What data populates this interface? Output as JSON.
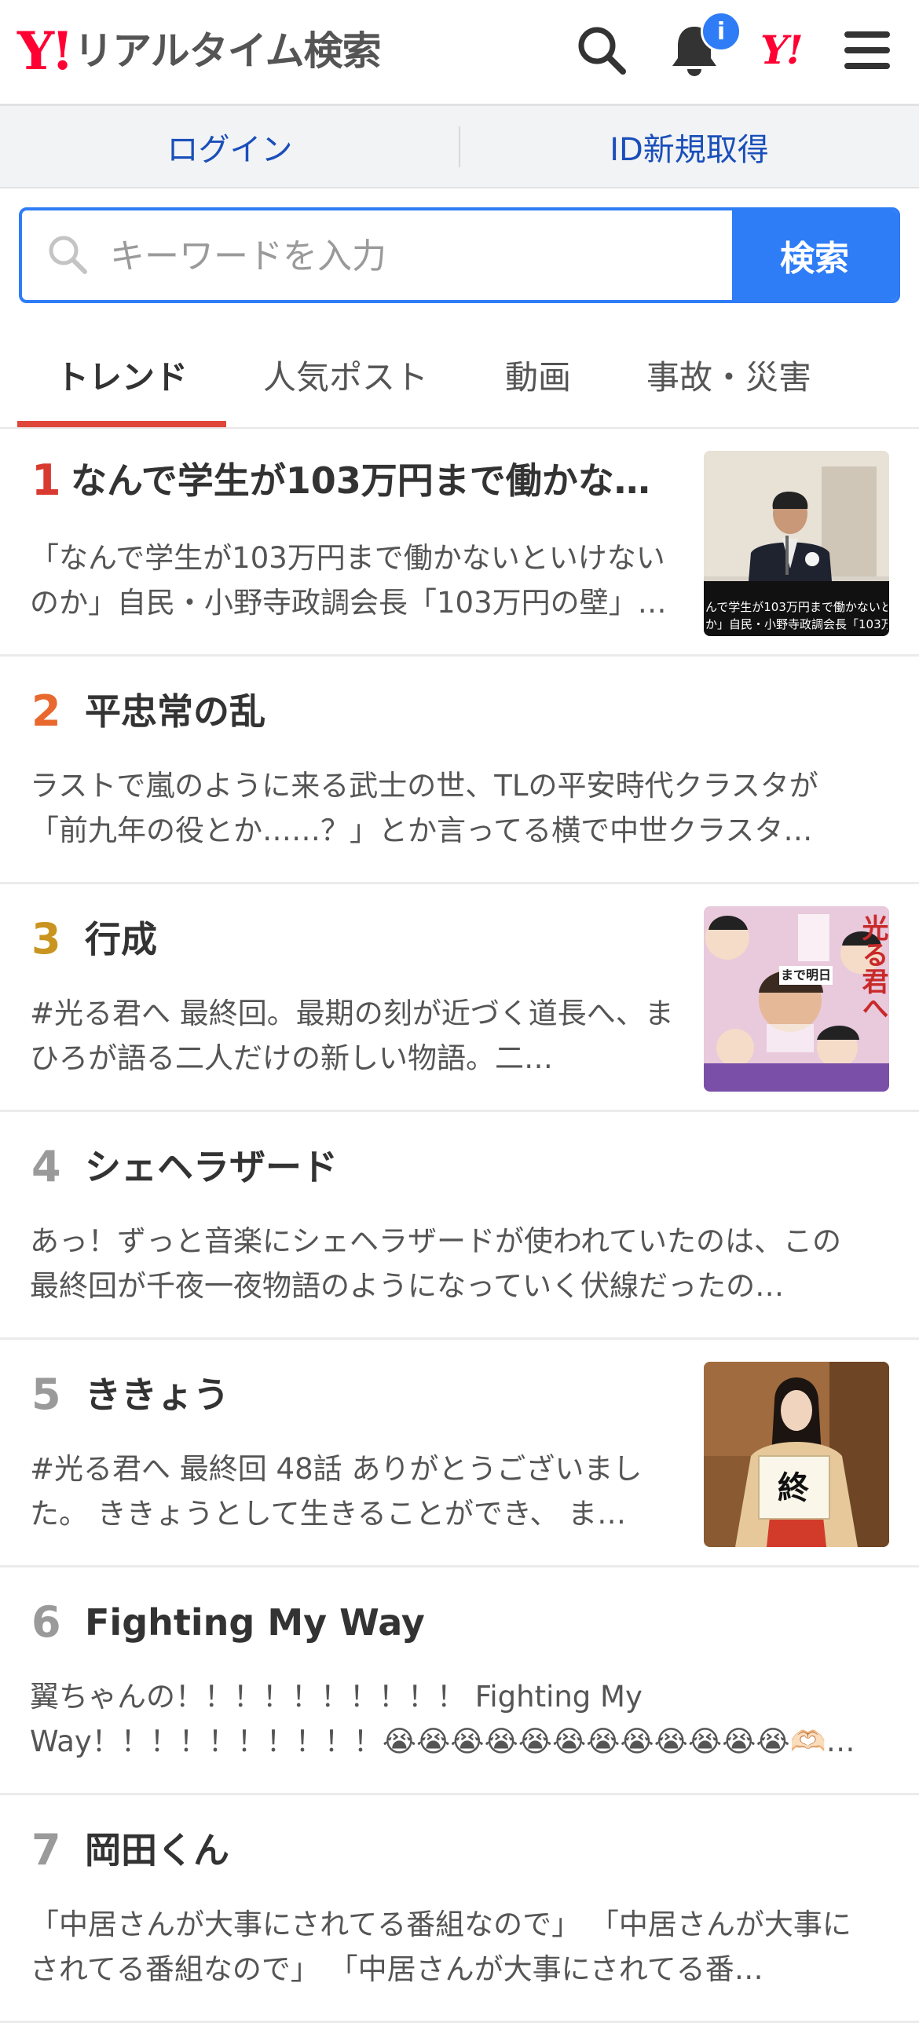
{
  "header": {
    "logo_mark": "Y!",
    "logo_text": "リアルタイム検索",
    "notification_badge": "i",
    "yahoo_mini_logo": "Y!",
    "icons": [
      "search-icon",
      "bell-icon",
      "yahoo-logo-icon",
      "menu-icon"
    ]
  },
  "auth": {
    "login": "ログイン",
    "signup": "ID新規取得"
  },
  "search": {
    "placeholder": "キーワードを入力",
    "value": "",
    "button": "検索"
  },
  "tabs": [
    {
      "label": "トレンド",
      "active": true
    },
    {
      "label": "人気ポスト",
      "active": false
    },
    {
      "label": "動画",
      "active": false
    },
    {
      "label": "事故・災害",
      "active": false
    }
  ],
  "colors": {
    "accent_blue": "#2e7cf6",
    "link_blue": "#1a4fba",
    "tab_underline": "#e0473a",
    "rank1": "#d93a30",
    "rank2": "#e8682e",
    "rank3": "#c99520",
    "rank_other": "#9a9a9a"
  },
  "trends": [
    {
      "rank": "1",
      "title": "なんで学生が103万円まで働かな…",
      "desc": "「なんで学生が103万円まで働かないといけないのか」自民・小野寺政調会長「103万円の壁」…",
      "thumbnail": true,
      "thumb_caption_1": "んで学生が103万円まで働かないとい",
      "thumb_caption_2": "か」自民・小野寺政調会長「103万円…"
    },
    {
      "rank": "2",
      "title": "平忠常の乱",
      "desc": "ラストで嵐のように来る武士の世、TLの平安時代クラスタが「前九年の役とか……？」とか言ってる横で中世クラスタ…",
      "thumbnail": false
    },
    {
      "rank": "3",
      "title": "行成",
      "desc": "#光る君へ 最終回。最期の刻が近づく道長へ、まひろが語る二人だけの新しい物語。二…",
      "thumbnail": true,
      "thumb_text_1": "光る君へ",
      "thumb_text_2": "まで明日"
    },
    {
      "rank": "4",
      "title": "シェヘラザード",
      "desc": "あっ！ずっと音楽にシェヘラザードが使われていたのは、この最終回が千夜一夜物語のようになっていく伏線だったの…",
      "thumbnail": false
    },
    {
      "rank": "5",
      "title": "ききょう",
      "desc": "#光る君へ 最終回 48話 ありがとうございました。 ききょうとして生きることができ、 ま…",
      "thumbnail": true,
      "thumb_text_1": "終"
    },
    {
      "rank": "6",
      "title": "Fighting My Way",
      "desc": "翼ちゃんの！！！！！！！！！！ Fighting My Way！！！！！！！！！！😭😭😭😭😭😭😭😭😭😭😭😭🫶🏻…",
      "thumbnail": false
    },
    {
      "rank": "7",
      "title": "岡田くん",
      "desc": "「中居さんが大事にされてる番組なので」 「中居さんが大事にされてる番組なので」 「中居さんが大事にされてる番…",
      "thumbnail": false
    }
  ]
}
